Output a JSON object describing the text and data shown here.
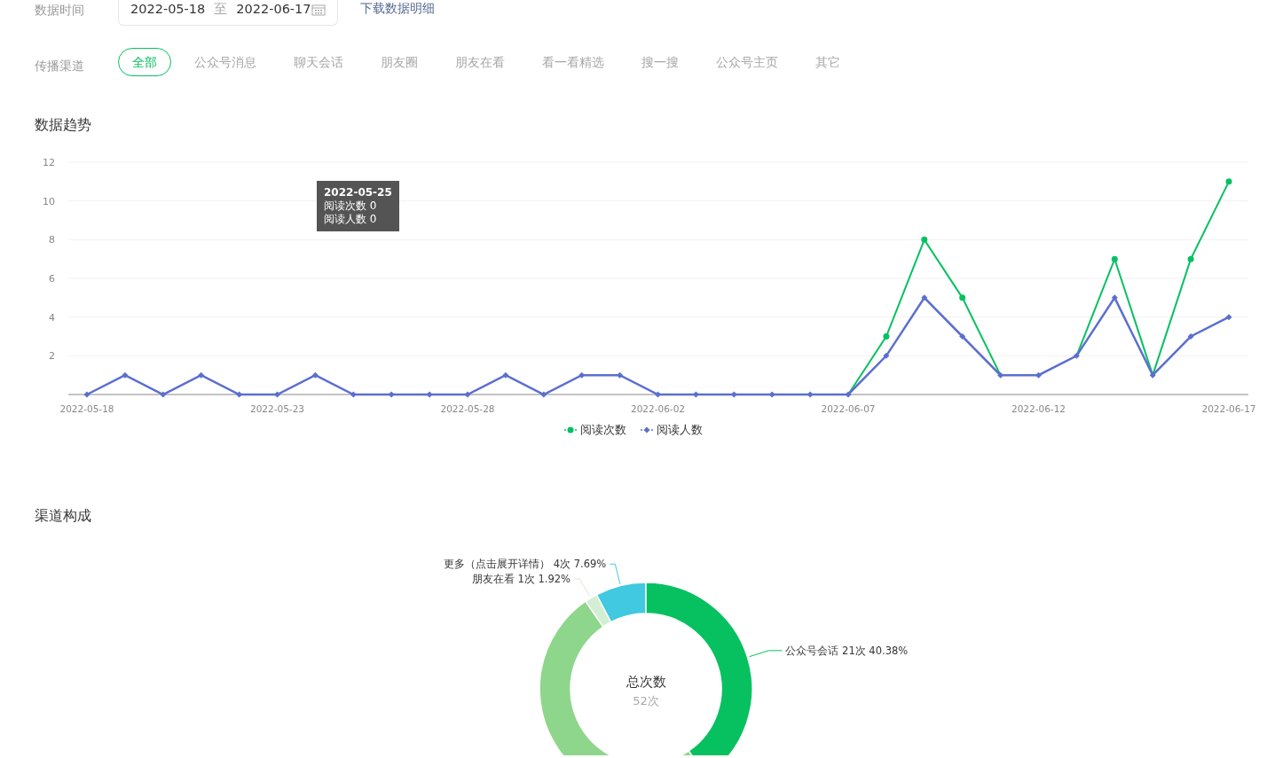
{
  "filters": {
    "date_label": "数据时间",
    "date_range": {
      "start": "2022-05-18",
      "separator": "至",
      "end": "2022-06-17"
    },
    "download_link": "下载数据明细",
    "channel_label": "传播渠道",
    "channels": [
      {
        "label": "全部",
        "selected": true
      },
      {
        "label": "公众号消息",
        "selected": false
      },
      {
        "label": "聊天会话",
        "selected": false
      },
      {
        "label": "朋友圈",
        "selected": false
      },
      {
        "label": "朋友在看",
        "selected": false
      },
      {
        "label": "看一看精选",
        "selected": false
      },
      {
        "label": "搜一搜",
        "selected": false
      },
      {
        "label": "公众号主页",
        "selected": false
      },
      {
        "label": "其它",
        "selected": false
      }
    ]
  },
  "trend": {
    "title": "数据趋势",
    "tooltip": {
      "title": "2022-05-25",
      "lines": [
        "阅读次数 0",
        "阅读人数 0"
      ]
    },
    "chart_data": {
      "type": "line",
      "categories": [
        "2022-05-18",
        null,
        null,
        null,
        null,
        "2022-05-23",
        null,
        null,
        null,
        null,
        "2022-05-28",
        null,
        null,
        null,
        null,
        "2022-06-02",
        null,
        null,
        null,
        null,
        "2022-06-07",
        null,
        null,
        null,
        null,
        "2022-06-12",
        null,
        null,
        null,
        null,
        "2022-06-17"
      ],
      "series": [
        {
          "name": "阅读次数",
          "color": "#07c160",
          "marker": "circle",
          "values": [
            null,
            null,
            null,
            null,
            null,
            null,
            null,
            null,
            null,
            null,
            null,
            null,
            null,
            null,
            null,
            null,
            null,
            null,
            null,
            null,
            0,
            3,
            8,
            5,
            1,
            null,
            2,
            7,
            1,
            7,
            11
          ]
        },
        {
          "name": "阅读人数",
          "color": "#5b6fcf",
          "marker": "diamond",
          "values": [
            0,
            1,
            0,
            1,
            0,
            0,
            1,
            0,
            0,
            0,
            0,
            1,
            0,
            1,
            1,
            0,
            0,
            0,
            0,
            0,
            0,
            2,
            5,
            3,
            1,
            1,
            2,
            5,
            1,
            3,
            4
          ]
        }
      ],
      "ylim": [
        0,
        12
      ],
      "yticks": [
        2,
        4,
        6,
        8,
        10,
        12
      ],
      "grid": true,
      "legend": true
    }
  },
  "composition": {
    "title": "渠道构成",
    "center_title": "总次数",
    "center_value": "52次",
    "chart_data": {
      "type": "donut",
      "categories": [
        "更多（点击展开详情）",
        "朋友在看",
        null,
        "公众号会话"
      ],
      "values": [
        7.69,
        1.92,
        50.01,
        40.38
      ],
      "colors": [
        "#40c9e0",
        "#d2eed3",
        "#8ed68b",
        "#07c160"
      ],
      "value_labels": [
        "4次 7.69%",
        "1次 1.92%",
        null,
        "21次 40.38%"
      ]
    }
  }
}
